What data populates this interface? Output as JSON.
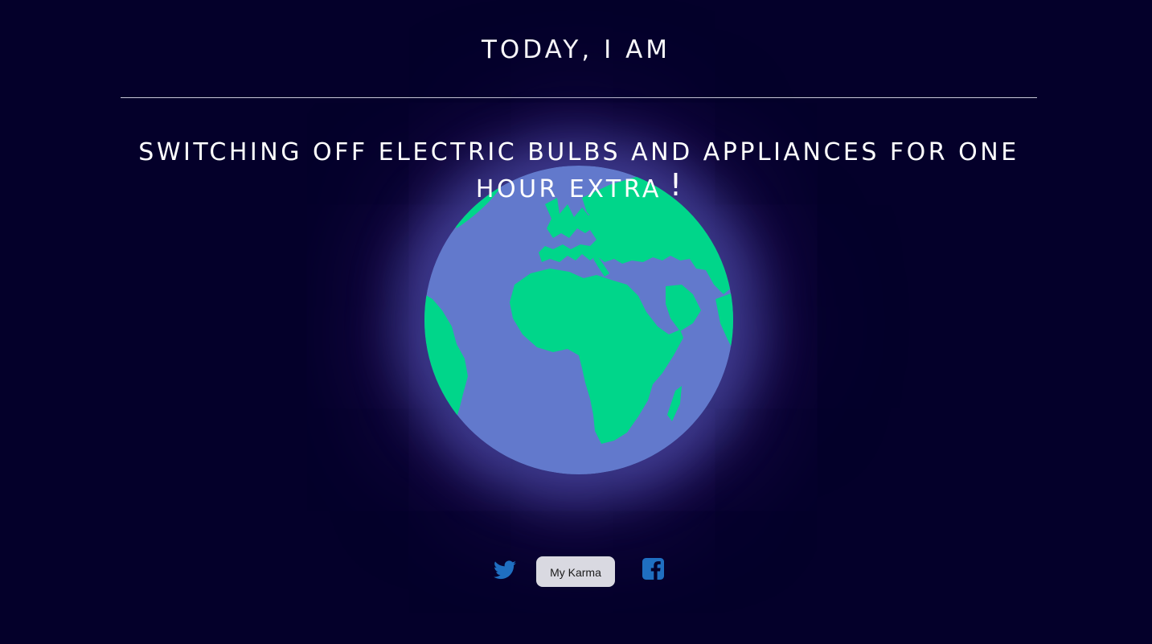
{
  "header": {
    "title": "TODAY, I AM"
  },
  "main": {
    "action_text": "SWITCHING OFF ELECTRIC BULBS AND APPLIANCES FOR ONE HOUR EXTRA",
    "exclamation": "!",
    "image": "earth-globe-icon"
  },
  "footer": {
    "karma_button_label": "My Karma",
    "icons": [
      "twitter-icon",
      "facebook-icon"
    ]
  },
  "colors": {
    "background": "#04002a",
    "ocean": "#6279cc",
    "land": "#00d68a",
    "social_icon": "#1f6fc1",
    "button_bg": "#d9d9e1",
    "text": "#ffffff"
  }
}
